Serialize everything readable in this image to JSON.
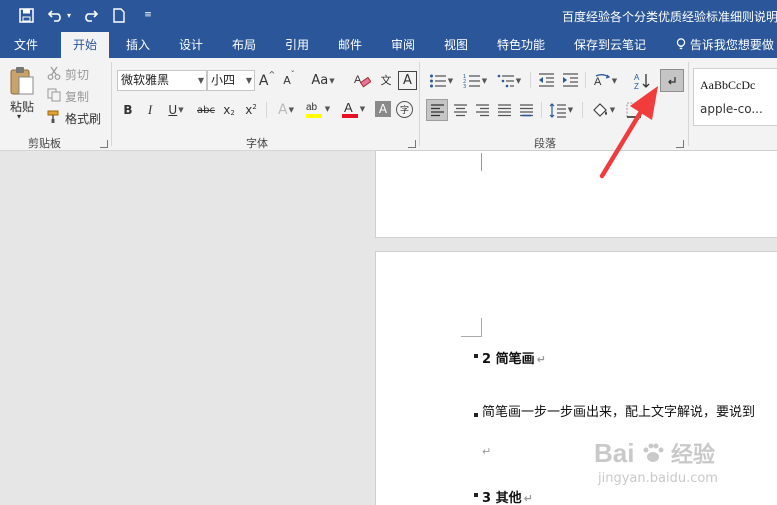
{
  "window": {
    "title": "百度经验各个分类优质经验标准细则说明"
  },
  "quick_access": [
    {
      "icon": "save-icon"
    },
    {
      "icon": "undo-icon"
    },
    {
      "icon": "redo-icon"
    },
    {
      "icon": "new-document-icon"
    },
    {
      "icon": "customize-dropdown-icon"
    }
  ],
  "tabs": [
    "文件",
    "开始",
    "插入",
    "设计",
    "布局",
    "引用",
    "邮件",
    "审阅",
    "视图",
    "特色功能",
    "保存到云笔记"
  ],
  "active_tab": "开始",
  "tell_me": "告诉我您想要做",
  "clipboard": {
    "paste": "粘贴",
    "cut": "剪切",
    "copy": "复制",
    "format_painter": "格式刷",
    "group_label": "剪贴板"
  },
  "font": {
    "font_name": "微软雅黑",
    "font_size": "小四",
    "grow": "A",
    "shrink": "A",
    "change_case": "Aa",
    "clear_format": "A",
    "char_border": "A",
    "bold": "B",
    "italic": "I",
    "underline": "U",
    "strikethrough": "abc",
    "subscript": "x",
    "superscript": "x",
    "text_effects": "A",
    "highlight": "ab",
    "font_color": "A",
    "char_shading": "A",
    "enclose_char": "字",
    "wen": "文",
    "group_label": "字体"
  },
  "paragraph": {
    "group_label": "段落",
    "sort": "A",
    "show_marks": "↲"
  },
  "styles": {
    "preview": "AaBbCcDc",
    "name": "apple-co..."
  },
  "document": {
    "heading_2": "2 简笔画",
    "body_text": "简笔画一步一步画出来，配上文字解说，要说到",
    "heading_3": "3 其他",
    "para_mark": "↵"
  },
  "watermark": {
    "brand": "Bai",
    "brand2": "经验",
    "url": "jingyan.baidu.com"
  },
  "colors": {
    "title_bar": "#2b579a",
    "ribbon": "#f3f3f3",
    "highlight_yellow": "#ffff00",
    "font_color_red": "#e81123",
    "arrow_red": "#f03c3c"
  }
}
